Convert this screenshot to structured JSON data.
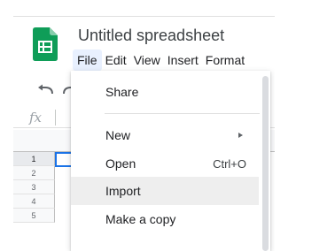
{
  "document": {
    "title": "Untitled spreadsheet"
  },
  "menubar": [
    "File",
    "Edit",
    "View",
    "Insert",
    "Format"
  ],
  "formula_bar": {
    "fx_label": "fx"
  },
  "grid": {
    "row_numbers": [
      "1",
      "2",
      "3",
      "4",
      "5"
    ]
  },
  "file_menu": {
    "share": "Share",
    "new": "New",
    "open": "Open",
    "open_shortcut": "Ctrl+O",
    "import": "Import",
    "make_copy": "Make a copy"
  },
  "colors": {
    "sheets_green": "#0f9d58",
    "selection_blue": "#1a73e8",
    "hover_grey": "#eeeeee",
    "active_menu_bg": "#e8f0fe"
  },
  "icons": {
    "app_logo": "sheets-logo-icon",
    "undo": "undo-icon",
    "redo": "redo-icon",
    "submenu": "submenu-arrow-icon"
  }
}
